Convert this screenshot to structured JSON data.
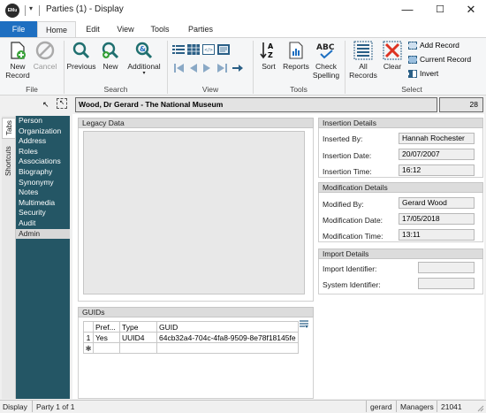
{
  "window": {
    "title": "Parties (1) - Display",
    "app_icon": "EMu",
    "minimize": "—",
    "maximize": "☐",
    "close": "✕"
  },
  "ribbon_tabs": [
    "File",
    "Home",
    "Edit",
    "View",
    "Tools",
    "Parties"
  ],
  "ribbon": {
    "file_group": {
      "label": "File",
      "new_record": "New Record",
      "new_record_l1": "New",
      "new_record_l2": "Record",
      "cancel": "Cancel"
    },
    "search_group": {
      "label": "Search",
      "previous": "Previous",
      "new": "New",
      "additional": "Additional"
    },
    "view_group": {
      "label": "View"
    },
    "tools_group": {
      "label": "Tools",
      "sort": "Sort",
      "reports": "Reports",
      "check_spelling_l1": "Check",
      "check_spelling_l2": "Spelling"
    },
    "select_group": {
      "label": "Select",
      "all_records_l1": "All",
      "all_records_l2": "Records",
      "clear": "Clear",
      "add_record": "Add Record",
      "current_record": "Current Record",
      "invert": "Invert"
    }
  },
  "record": {
    "title": "Wood, Dr Gerard - The National Museum",
    "count": "28"
  },
  "vertical_tabs": [
    "Tabs",
    "Shortcuts"
  ],
  "nav_items": [
    "Person",
    "Organization",
    "Address",
    "Roles",
    "Associations",
    "Biography",
    "Synonymy",
    "Notes",
    "Multimedia",
    "Security",
    "Audit",
    "Admin"
  ],
  "nav_selected": "Admin",
  "legacy": {
    "header": "Legacy Data"
  },
  "insertion": {
    "header": "Insertion Details",
    "inserted_by_label": "Inserted By:",
    "inserted_by": "Hannah Rochester",
    "insertion_date_label": "Insertion Date:",
    "insertion_date": "20/07/2007",
    "insertion_time_label": "Insertion Time:",
    "insertion_time": "16:12"
  },
  "modification": {
    "header": "Modification Details",
    "modified_by_label": "Modified By:",
    "modified_by": "Gerard Wood",
    "modification_date_label": "Modification Date:",
    "modification_date": "17/05/2018",
    "modification_time_label": "Modification Time:",
    "modification_time": "13:11"
  },
  "import": {
    "header": "Import Details",
    "import_identifier_label": "Import Identifier:",
    "import_identifier": "",
    "system_identifier_label": "System Identifier:",
    "system_identifier": ""
  },
  "guids": {
    "header": "GUIDs",
    "columns": [
      "Pref...",
      "Type",
      "GUID"
    ],
    "rows": [
      {
        "num": "1",
        "pref": "Yes",
        "type": "UUID4",
        "guid": "64cb32a4-704c-4fa8-9509-8e78f18145fe"
      }
    ],
    "new_row_marker": "✱"
  },
  "status": {
    "mode": "Display",
    "position": "Party 1 of 1",
    "user": "gerard",
    "group": "Managers",
    "number": "21041"
  }
}
